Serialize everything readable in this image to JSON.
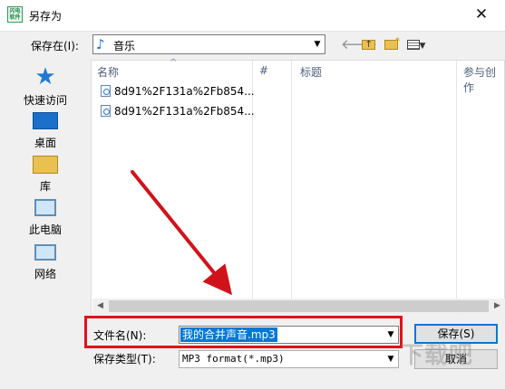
{
  "window": {
    "title": "另存为",
    "app_icon_text": "闪电软件",
    "close_label": "✕"
  },
  "toolbar": {
    "save_in_label": "保存在(I):",
    "save_in_value": "音乐"
  },
  "places": [
    {
      "label": "快速访问",
      "icon": "star-icon"
    },
    {
      "label": "桌面",
      "icon": "desktop-icon"
    },
    {
      "label": "库",
      "icon": "library-icon"
    },
    {
      "label": "此电脑",
      "icon": "computer-icon"
    },
    {
      "label": "网络",
      "icon": "network-icon"
    }
  ],
  "file_list": {
    "columns": [
      "名称",
      "#",
      "标题",
      "参与创作"
    ],
    "files": [
      {
        "name": "8d91%2F131a%2Fb854..."
      },
      {
        "name": "8d91%2F131a%2Fb854..."
      }
    ]
  },
  "form": {
    "filename_label": "文件名(N):",
    "filename_value": "我的合并声音.mp3",
    "filetype_label": "保存类型(T):",
    "filetype_value": "MP3 format(*.mp3)"
  },
  "buttons": {
    "save": "保存(S)",
    "cancel": "取消"
  },
  "annotation": {
    "highlight_color": "#e0121a"
  },
  "watermark_text": "下载吧"
}
